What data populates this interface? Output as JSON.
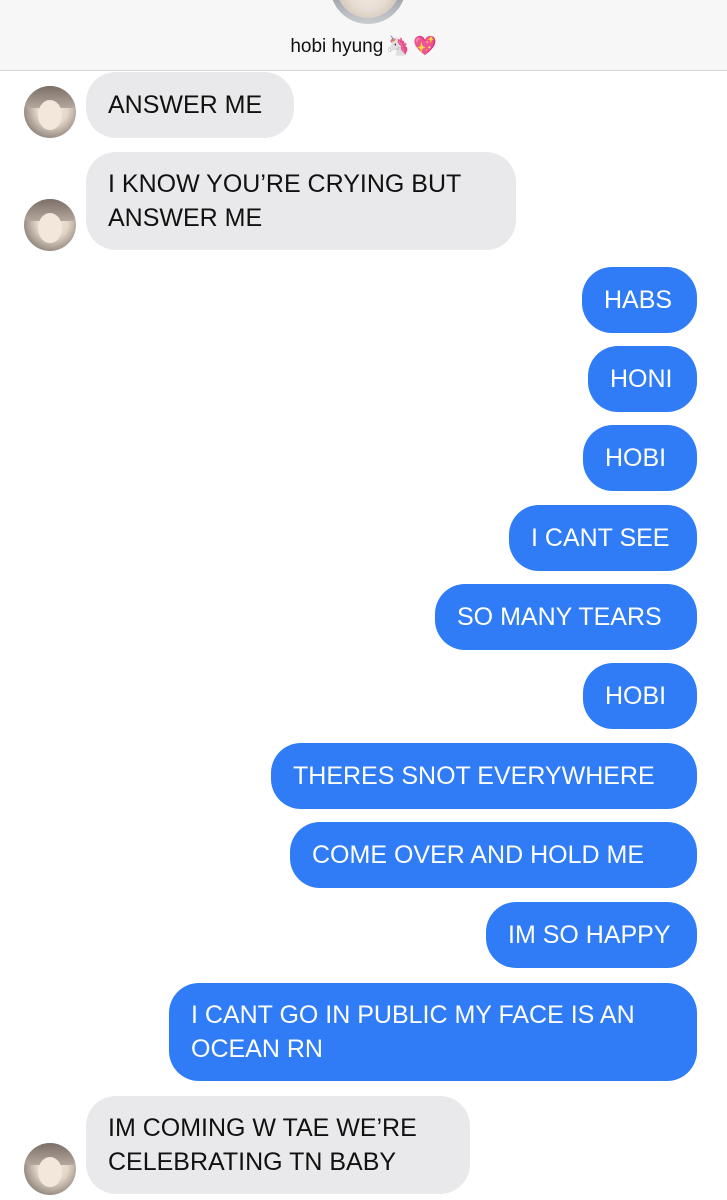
{
  "header": {
    "contact_name": "hobi hyung",
    "emoji_1": "🦄",
    "emoji_2": "💖"
  },
  "messages": [
    {
      "sender": "contact",
      "text": "ANSWER ME"
    },
    {
      "sender": "contact",
      "text": "I KNOW YOU’RE CRYING BUT\nANSWER ME"
    },
    {
      "sender": "me",
      "text": "HABS"
    },
    {
      "sender": "me",
      "text": "HONI"
    },
    {
      "sender": "me",
      "text": "HOBI"
    },
    {
      "sender": "me",
      "text": "I CANT SEE"
    },
    {
      "sender": "me",
      "text": "SO MANY TEARS"
    },
    {
      "sender": "me",
      "text": "HOBI"
    },
    {
      "sender": "me",
      "text": "THERES SNOT EVERYWHERE"
    },
    {
      "sender": "me",
      "text": "COME OVER AND HOLD ME"
    },
    {
      "sender": "me",
      "text": "IM SO HAPPY"
    },
    {
      "sender": "me",
      "text": "I CANT GO IN PUBLIC MY FACE IS AN\nOCEAN RN"
    },
    {
      "sender": "contact",
      "text": "IM COMING W TAE WE’RE\nCELEBRATING TN BABY"
    }
  ],
  "colors": {
    "incoming_bubble": "#e9e9eb",
    "outgoing_bubble": "#2f7cf6",
    "header_bg": "#f7f7f7"
  }
}
